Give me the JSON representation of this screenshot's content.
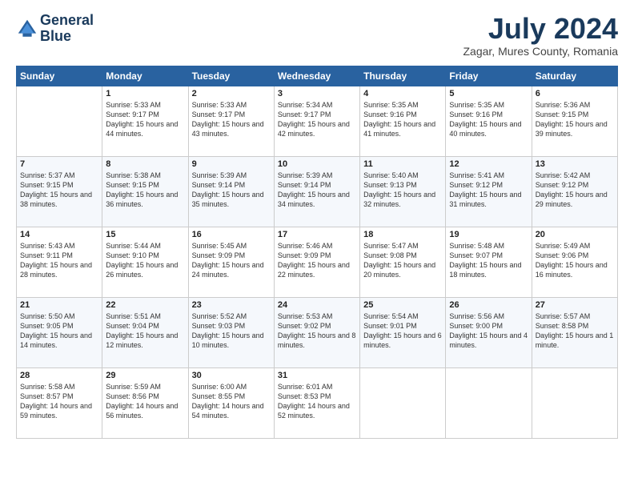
{
  "logo": {
    "line1": "General",
    "line2": "Blue"
  },
  "title": "July 2024",
  "subtitle": "Zagar, Mures County, Romania",
  "headers": [
    "Sunday",
    "Monday",
    "Tuesday",
    "Wednesday",
    "Thursday",
    "Friday",
    "Saturday"
  ],
  "weeks": [
    [
      {
        "day": "",
        "sunrise": "",
        "sunset": "",
        "daylight": ""
      },
      {
        "day": "1",
        "sunrise": "Sunrise: 5:33 AM",
        "sunset": "Sunset: 9:17 PM",
        "daylight": "Daylight: 15 hours and 44 minutes."
      },
      {
        "day": "2",
        "sunrise": "Sunrise: 5:33 AM",
        "sunset": "Sunset: 9:17 PM",
        "daylight": "Daylight: 15 hours and 43 minutes."
      },
      {
        "day": "3",
        "sunrise": "Sunrise: 5:34 AM",
        "sunset": "Sunset: 9:17 PM",
        "daylight": "Daylight: 15 hours and 42 minutes."
      },
      {
        "day": "4",
        "sunrise": "Sunrise: 5:35 AM",
        "sunset": "Sunset: 9:16 PM",
        "daylight": "Daylight: 15 hours and 41 minutes."
      },
      {
        "day": "5",
        "sunrise": "Sunrise: 5:35 AM",
        "sunset": "Sunset: 9:16 PM",
        "daylight": "Daylight: 15 hours and 40 minutes."
      },
      {
        "day": "6",
        "sunrise": "Sunrise: 5:36 AM",
        "sunset": "Sunset: 9:15 PM",
        "daylight": "Daylight: 15 hours and 39 minutes."
      }
    ],
    [
      {
        "day": "7",
        "sunrise": "Sunrise: 5:37 AM",
        "sunset": "Sunset: 9:15 PM",
        "daylight": "Daylight: 15 hours and 38 minutes."
      },
      {
        "day": "8",
        "sunrise": "Sunrise: 5:38 AM",
        "sunset": "Sunset: 9:15 PM",
        "daylight": "Daylight: 15 hours and 36 minutes."
      },
      {
        "day": "9",
        "sunrise": "Sunrise: 5:39 AM",
        "sunset": "Sunset: 9:14 PM",
        "daylight": "Daylight: 15 hours and 35 minutes."
      },
      {
        "day": "10",
        "sunrise": "Sunrise: 5:39 AM",
        "sunset": "Sunset: 9:14 PM",
        "daylight": "Daylight: 15 hours and 34 minutes."
      },
      {
        "day": "11",
        "sunrise": "Sunrise: 5:40 AM",
        "sunset": "Sunset: 9:13 PM",
        "daylight": "Daylight: 15 hours and 32 minutes."
      },
      {
        "day": "12",
        "sunrise": "Sunrise: 5:41 AM",
        "sunset": "Sunset: 9:12 PM",
        "daylight": "Daylight: 15 hours and 31 minutes."
      },
      {
        "day": "13",
        "sunrise": "Sunrise: 5:42 AM",
        "sunset": "Sunset: 9:12 PM",
        "daylight": "Daylight: 15 hours and 29 minutes."
      }
    ],
    [
      {
        "day": "14",
        "sunrise": "Sunrise: 5:43 AM",
        "sunset": "Sunset: 9:11 PM",
        "daylight": "Daylight: 15 hours and 28 minutes."
      },
      {
        "day": "15",
        "sunrise": "Sunrise: 5:44 AM",
        "sunset": "Sunset: 9:10 PM",
        "daylight": "Daylight: 15 hours and 26 minutes."
      },
      {
        "day": "16",
        "sunrise": "Sunrise: 5:45 AM",
        "sunset": "Sunset: 9:09 PM",
        "daylight": "Daylight: 15 hours and 24 minutes."
      },
      {
        "day": "17",
        "sunrise": "Sunrise: 5:46 AM",
        "sunset": "Sunset: 9:09 PM",
        "daylight": "Daylight: 15 hours and 22 minutes."
      },
      {
        "day": "18",
        "sunrise": "Sunrise: 5:47 AM",
        "sunset": "Sunset: 9:08 PM",
        "daylight": "Daylight: 15 hours and 20 minutes."
      },
      {
        "day": "19",
        "sunrise": "Sunrise: 5:48 AM",
        "sunset": "Sunset: 9:07 PM",
        "daylight": "Daylight: 15 hours and 18 minutes."
      },
      {
        "day": "20",
        "sunrise": "Sunrise: 5:49 AM",
        "sunset": "Sunset: 9:06 PM",
        "daylight": "Daylight: 15 hours and 16 minutes."
      }
    ],
    [
      {
        "day": "21",
        "sunrise": "Sunrise: 5:50 AM",
        "sunset": "Sunset: 9:05 PM",
        "daylight": "Daylight: 15 hours and 14 minutes."
      },
      {
        "day": "22",
        "sunrise": "Sunrise: 5:51 AM",
        "sunset": "Sunset: 9:04 PM",
        "daylight": "Daylight: 15 hours and 12 minutes."
      },
      {
        "day": "23",
        "sunrise": "Sunrise: 5:52 AM",
        "sunset": "Sunset: 9:03 PM",
        "daylight": "Daylight: 15 hours and 10 minutes."
      },
      {
        "day": "24",
        "sunrise": "Sunrise: 5:53 AM",
        "sunset": "Sunset: 9:02 PM",
        "daylight": "Daylight: 15 hours and 8 minutes."
      },
      {
        "day": "25",
        "sunrise": "Sunrise: 5:54 AM",
        "sunset": "Sunset: 9:01 PM",
        "daylight": "Daylight: 15 hours and 6 minutes."
      },
      {
        "day": "26",
        "sunrise": "Sunrise: 5:56 AM",
        "sunset": "Sunset: 9:00 PM",
        "daylight": "Daylight: 15 hours and 4 minutes."
      },
      {
        "day": "27",
        "sunrise": "Sunrise: 5:57 AM",
        "sunset": "Sunset: 8:58 PM",
        "daylight": "Daylight: 15 hours and 1 minute."
      }
    ],
    [
      {
        "day": "28",
        "sunrise": "Sunrise: 5:58 AM",
        "sunset": "Sunset: 8:57 PM",
        "daylight": "Daylight: 14 hours and 59 minutes."
      },
      {
        "day": "29",
        "sunrise": "Sunrise: 5:59 AM",
        "sunset": "Sunset: 8:56 PM",
        "daylight": "Daylight: 14 hours and 56 minutes."
      },
      {
        "day": "30",
        "sunrise": "Sunrise: 6:00 AM",
        "sunset": "Sunset: 8:55 PM",
        "daylight": "Daylight: 14 hours and 54 minutes."
      },
      {
        "day": "31",
        "sunrise": "Sunrise: 6:01 AM",
        "sunset": "Sunset: 8:53 PM",
        "daylight": "Daylight: 14 hours and 52 minutes."
      },
      {
        "day": "",
        "sunrise": "",
        "sunset": "",
        "daylight": ""
      },
      {
        "day": "",
        "sunrise": "",
        "sunset": "",
        "daylight": ""
      },
      {
        "day": "",
        "sunrise": "",
        "sunset": "",
        "daylight": ""
      }
    ]
  ]
}
